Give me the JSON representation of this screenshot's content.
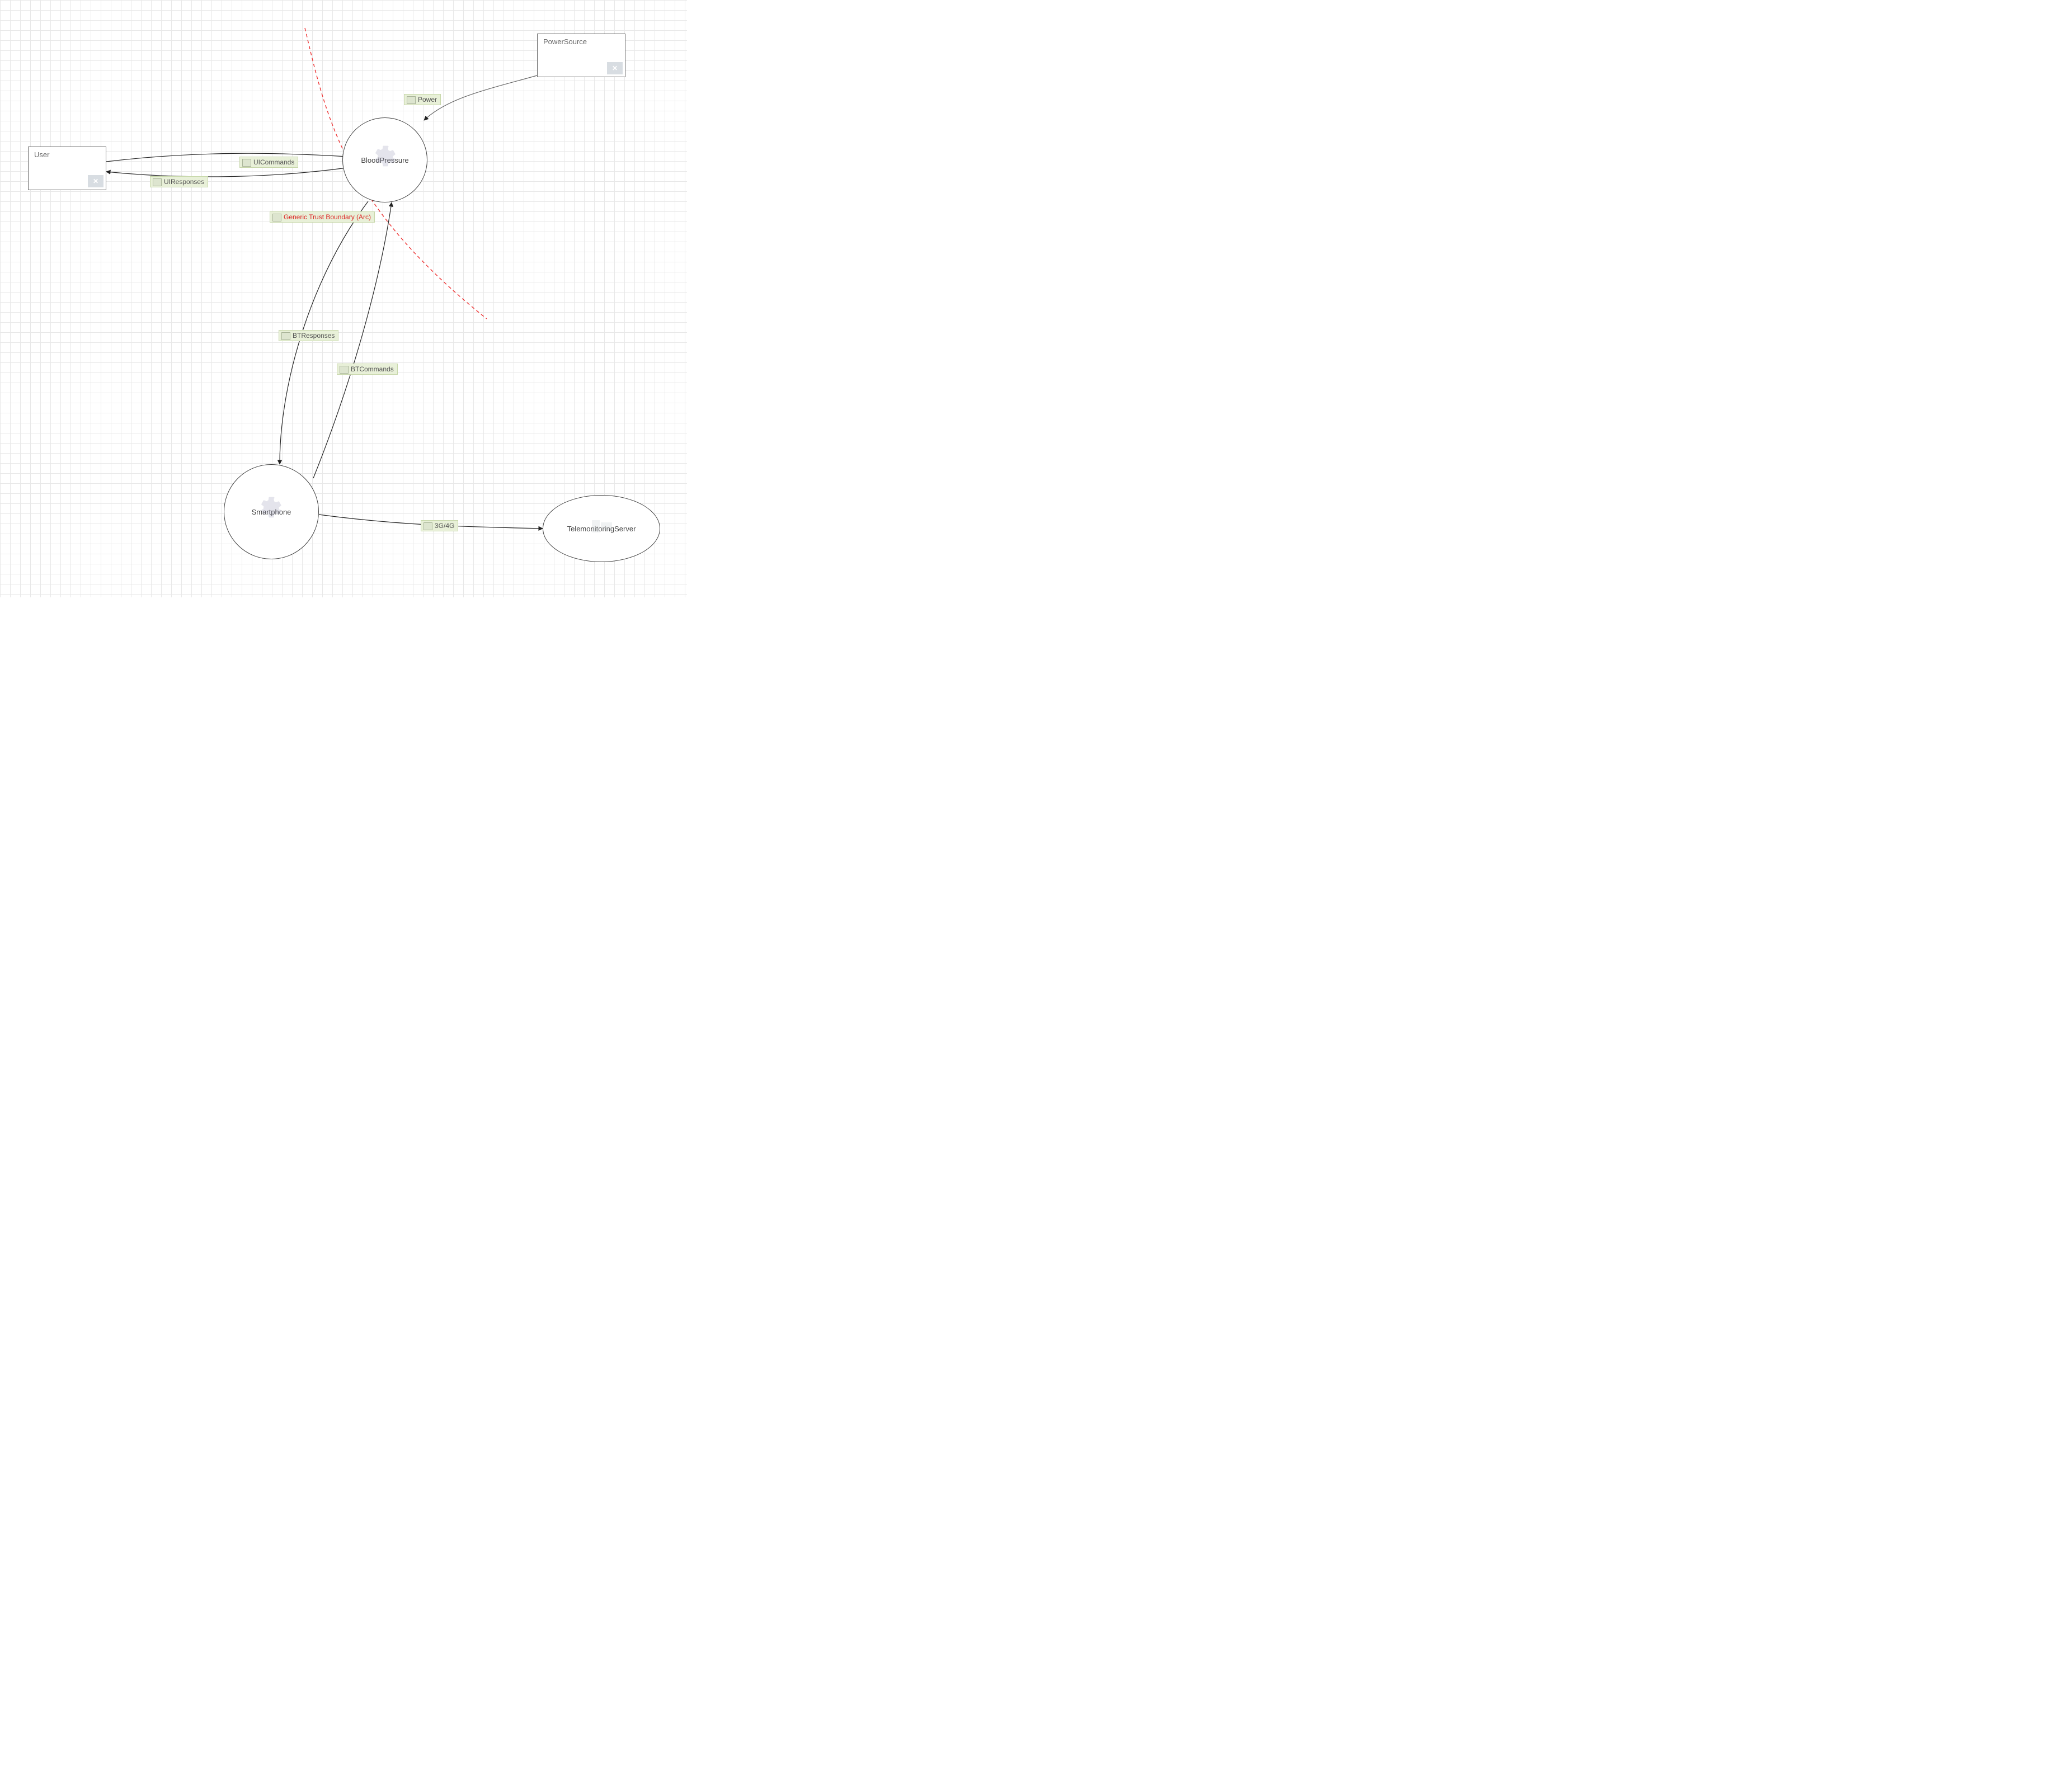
{
  "diagram": {
    "type": "threat-model-dfd",
    "nodes": {
      "user": {
        "kind": "external",
        "label": "User"
      },
      "powerSource": {
        "kind": "external",
        "label": "PowerSource"
      },
      "bloodPressure": {
        "kind": "process",
        "label": "BloodPressure"
      },
      "smartphone": {
        "kind": "process",
        "label": "Smartphone"
      },
      "telemonitoringServer": {
        "kind": "external-ellipse",
        "label": "TelemonitoringServer"
      }
    },
    "flows": {
      "uiCommands": {
        "from": "user",
        "to": "bloodPressure",
        "label": "UICommands"
      },
      "uiResponses": {
        "from": "bloodPressure",
        "to": "user",
        "label": "UIResponses"
      },
      "power": {
        "from": "powerSource",
        "to": "bloodPressure",
        "label": "Power"
      },
      "btResponses": {
        "from": "bloodPressure",
        "to": "smartphone",
        "label": "BTResponses"
      },
      "btCommands": {
        "from": "smartphone",
        "to": "bloodPressure",
        "label": "BTCommands"
      },
      "threeg": {
        "from": "smartphone",
        "to": "telemonitoringServer",
        "label": "3G/4G"
      }
    },
    "trustBoundary": {
      "label": "Generic Trust Boundary (Arc)"
    }
  }
}
